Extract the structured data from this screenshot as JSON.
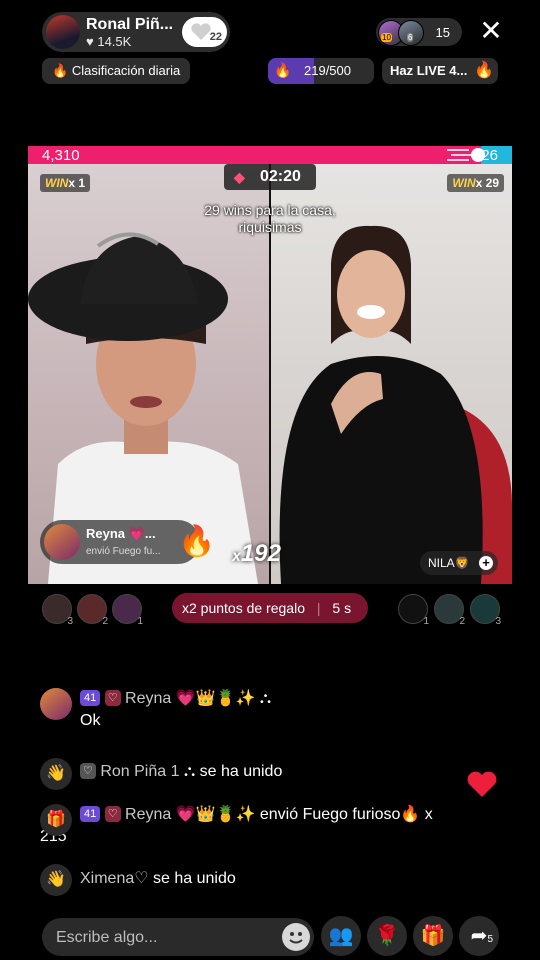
{
  "host": {
    "name": "Ronal Piñ...",
    "likes": "14.5K",
    "follow_count": "22"
  },
  "viewers": {
    "badge1": "10",
    "badge2": "6",
    "count": "15"
  },
  "daily_rank": {
    "label": "Clasificación diaria"
  },
  "goal_progress": {
    "text": "219/500",
    "fraction": 0.438
  },
  "goal_button": {
    "label": "Haz LIVE 4..."
  },
  "battle": {
    "left_score": "4,310",
    "right_score": "26",
    "left_fraction": 0.935,
    "timer": "02:20",
    "left_win": "WIN",
    "left_win_count": "x 1",
    "right_win": "WIN",
    "right_win_count": "x 29",
    "caption": "29 wins para la casa, riquisimas"
  },
  "gift_toast": {
    "sender": "Reyna 💗...",
    "sub": "envió Fuego fu...",
    "count_prefix": "x",
    "count": "192"
  },
  "opponent": {
    "name": "NILA🦁"
  },
  "multiplier": {
    "label": "x2 puntos de regalo",
    "seconds": "5 s"
  },
  "supporters_left": [
    "3",
    "2",
    "1"
  ],
  "supporters_right": [
    "1",
    "2",
    "3"
  ],
  "chat": {
    "msg1": {
      "level": "41",
      "fan": "♡",
      "name": "Reyna 💗👑🍍✨",
      "text": "Ok"
    },
    "join1": {
      "badge": "♡",
      "name": "Ron Piña 1",
      "text": "se ha unido"
    },
    "gift1": {
      "level": "41",
      "fan": "♡",
      "name": "Reyna 💗👑🍍✨",
      "text": "envió Fuego furioso🔥 x",
      "count": "215"
    },
    "join2": {
      "name": "Ximena♡",
      "text": "se ha unido"
    }
  },
  "input": {
    "placeholder": "Escribe algo..."
  },
  "share_count": "5",
  "colors": {
    "red_team": "#ee1f6c",
    "blue_team": "#22b7dd",
    "level_badge": "#6b4bd8",
    "multiplier_bg": "#7a1530"
  }
}
